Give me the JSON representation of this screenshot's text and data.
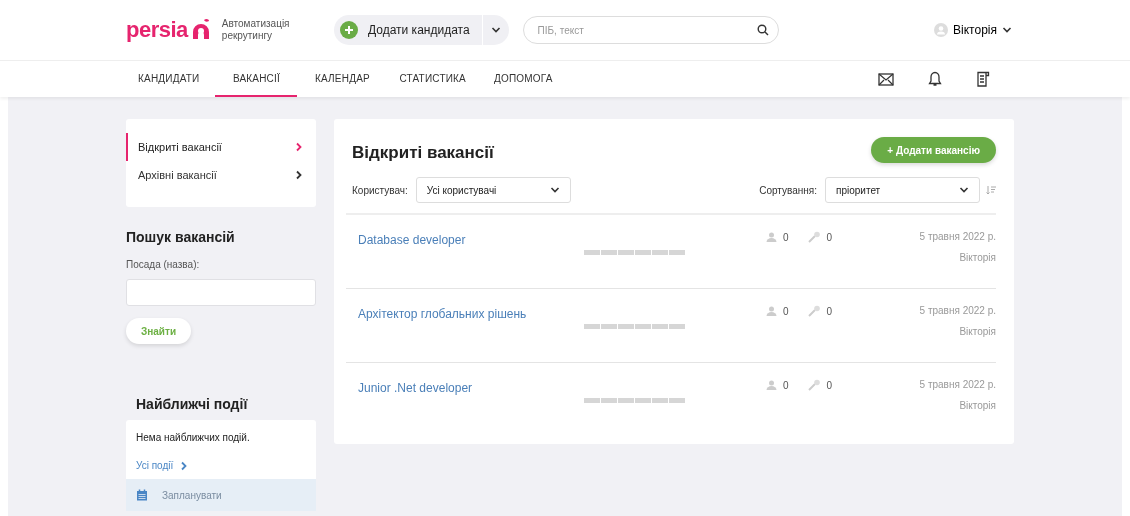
{
  "header": {
    "logo": "persia",
    "tagline": "Автоматизація рекрутингу",
    "add_candidate": "Додати кандидата",
    "search": {
      "placeholder": "ПІБ, текст"
    },
    "user": "Вікторія"
  },
  "nav": [
    {
      "label": "КАНДИДАТИ",
      "selected": false
    },
    {
      "label": "ВАКАНСІЇ",
      "selected": true
    },
    {
      "label": "КАЛЕНДАР",
      "selected": false
    },
    {
      "label": "СТАТИСТИКА",
      "selected": false
    },
    {
      "label": "ДОПОМОГА",
      "selected": false
    }
  ],
  "sidebar": {
    "items": [
      {
        "label": "Відкриті вакансії",
        "selected": true
      },
      {
        "label": "Архівні вакансії",
        "selected": false
      }
    ],
    "search_title": "Пошук вакансій",
    "field_label": "Посада (назва):",
    "find_button": "Знайти",
    "events_title": "Найближчі події",
    "events_empty": "Нема найближчих подій.",
    "all_events": "Усі події",
    "schedule": "Запланувати"
  },
  "main": {
    "title": "Відкриті вакансії",
    "add_button": "+ Додати вакансію",
    "user_label": "Користувач:",
    "user_value": "Усі користувачі",
    "sort_label": "Сортування:",
    "sort_value": "пріоритет",
    "vacancies": [
      {
        "title": "Database developer",
        "candidates": "0",
        "interviews": "0",
        "date": "5 травня 2022 р.",
        "owner": "Вікторія"
      },
      {
        "title": "Архітектор глобальних рішень",
        "candidates": "0",
        "interviews": "0",
        "date": "5 травня 2022 р.",
        "owner": "Вікторія"
      },
      {
        "title": "Junior .Net developer",
        "candidates": "0",
        "interviews": "0",
        "date": "5 травня 2022 р.",
        "owner": "Вікторія"
      }
    ]
  }
}
